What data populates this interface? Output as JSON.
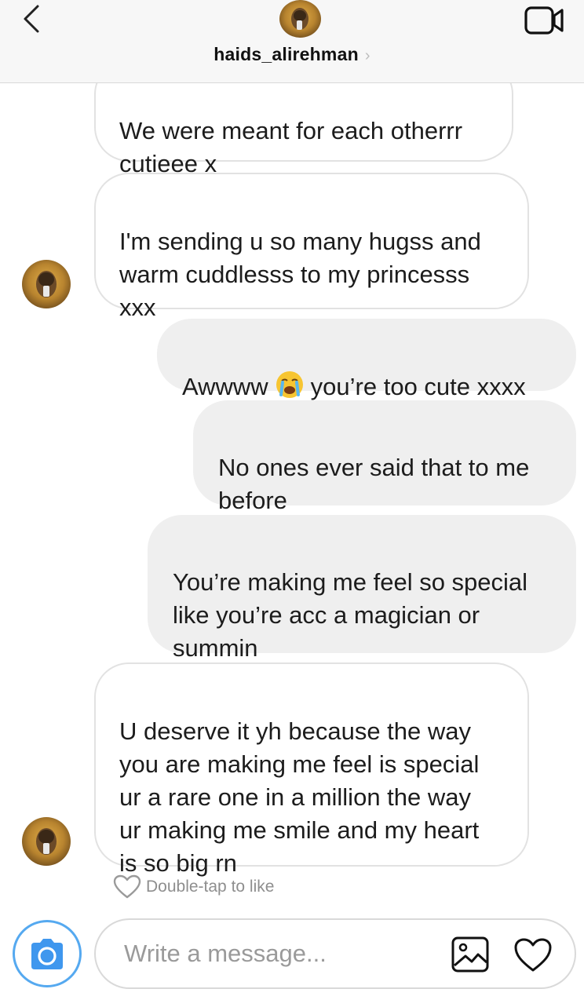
{
  "header": {
    "username": "haids_alirehman",
    "chevron": "›",
    "back_icon": "chevron-left-icon",
    "video_icon": "video-camera-icon"
  },
  "messages": [
    {
      "direction": "incoming",
      "text": "We were meant for each otherrr\ncutieee x"
    },
    {
      "direction": "incoming",
      "text": "I'm sending u so many hugss and\nwarm cuddlesss to my princesss\nxxx"
    },
    {
      "direction": "outgoing",
      "text_before": "Awwww",
      "emoji": "loudly-crying-face-emoji",
      "text_after": "you’re too cute xxxx"
    },
    {
      "direction": "outgoing",
      "text": "No ones ever said that to me\nbefore"
    },
    {
      "direction": "outgoing",
      "text": "You’re making me feel so special\nlike you’re acc a magician or\nsummin"
    },
    {
      "direction": "incoming",
      "text": "U deserve it yh because the way\nyou are making me feel is special\nur a rare one in a million the way\nur making me smile and my heart\nis so big rn"
    }
  ],
  "like_hint": "Double-tap to like",
  "composer": {
    "placeholder": "Write a message...",
    "camera_icon": "camera-icon",
    "gallery_icon": "image-gallery-icon",
    "heart_icon": "heart-icon"
  },
  "colors": {
    "accent_blue": "#3f97ee",
    "outgoing_bubble": "#efefef",
    "incoming_border": "#e2e2e2"
  }
}
